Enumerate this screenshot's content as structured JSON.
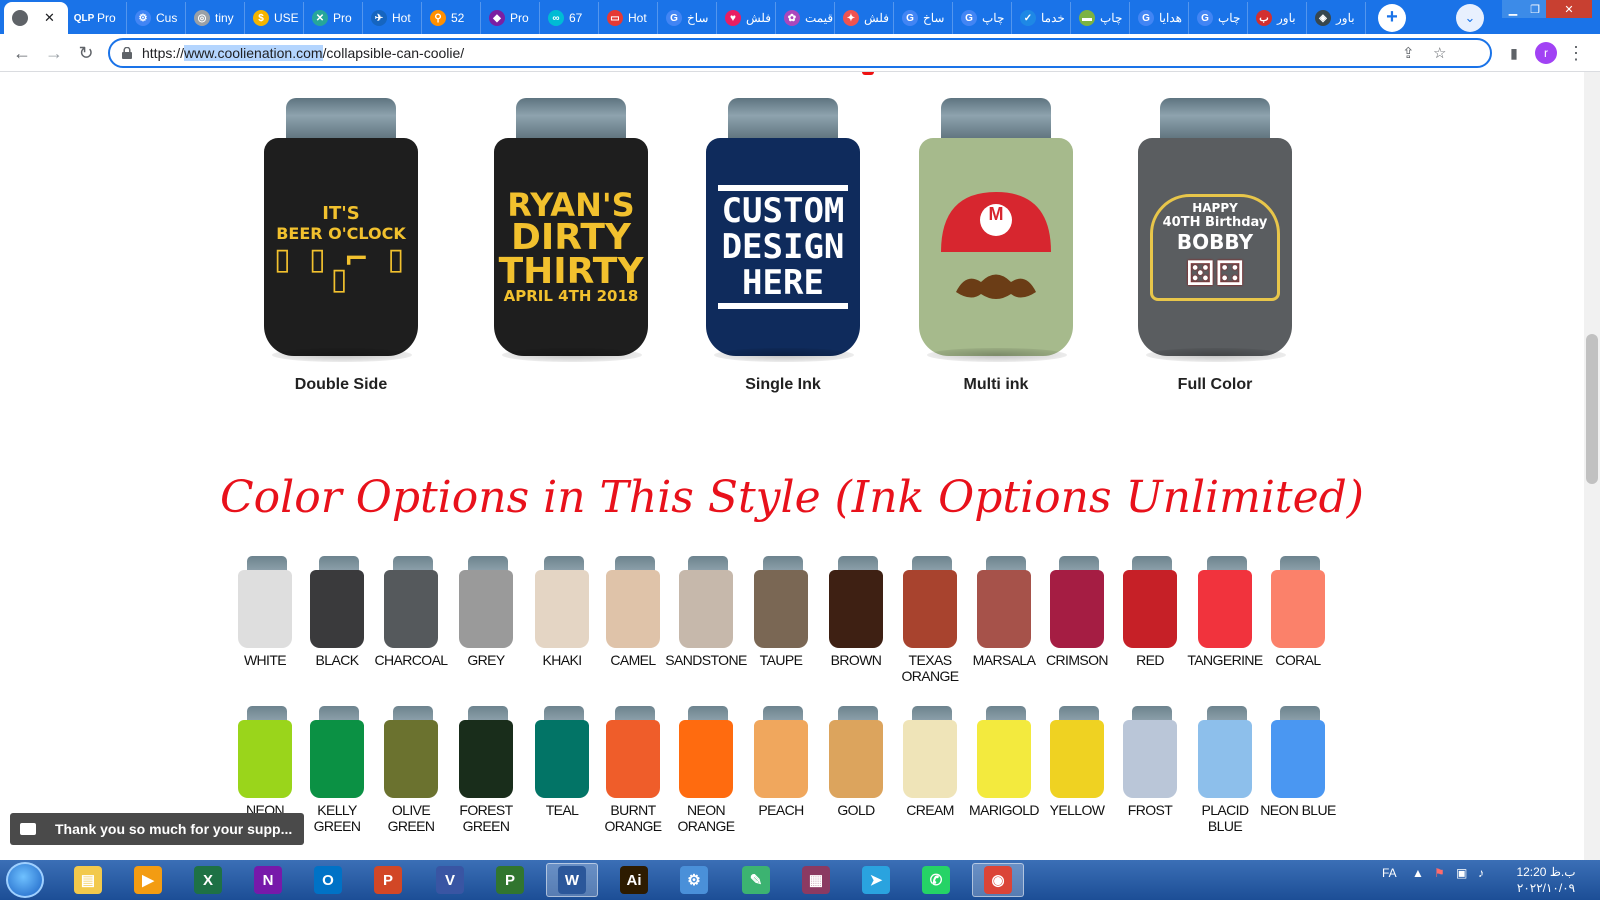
{
  "browser": {
    "tabs": [
      {
        "label": "",
        "favicon": "globe-icon",
        "color": "#5f6368",
        "active": true
      },
      {
        "label": "Pro",
        "favicon": "qlp-icon",
        "color": "#1a73e8",
        "glyph": "QLP"
      },
      {
        "label": "Cus",
        "favicon": "gear-icon",
        "color": "#4285f4",
        "glyph": "⚙"
      },
      {
        "label": "tiny",
        "favicon": "globe-icon",
        "color": "#9aa0a6",
        "glyph": "◎"
      },
      {
        "label": "USE",
        "favicon": "coin-icon",
        "color": "#f4b400",
        "glyph": "$"
      },
      {
        "label": "Pro",
        "favicon": "cross-circle-icon",
        "color": "#26a69a",
        "glyph": "✕"
      },
      {
        "label": "Hot",
        "favicon": "wing-icon",
        "color": "#1565c0",
        "glyph": "✈"
      },
      {
        "label": "52",
        "favicon": "map-pin-icon",
        "color": "#ff8f00",
        "glyph": "⚲"
      },
      {
        "label": "Pro",
        "favicon": "diamond-icon",
        "color": "#7b1fa2",
        "glyph": "◆"
      },
      {
        "label": "67",
        "favicon": "ring-icon",
        "color": "#00bcd4",
        "glyph": "∞"
      },
      {
        "label": "Hot",
        "favicon": "tag-icon",
        "color": "#e53935",
        "glyph": "▭"
      },
      {
        "label": "ساخ",
        "favicon": "google-icon",
        "color": "#4285f4",
        "glyph": "G"
      },
      {
        "label": "فلش",
        "favicon": "heart-icon",
        "color": "#e91e63",
        "glyph": "♥"
      },
      {
        "label": "قیمت",
        "favicon": "gift-icon",
        "color": "#ab47bc",
        "glyph": "✿"
      },
      {
        "label": "فلش",
        "favicon": "fire-icon",
        "color": "#ef5350",
        "glyph": "✦"
      },
      {
        "label": "ساخ",
        "favicon": "google-icon",
        "color": "#4285f4",
        "glyph": "G"
      },
      {
        "label": "چاپ",
        "favicon": "google-icon",
        "color": "#4285f4",
        "glyph": "G"
      },
      {
        "label": "خدما",
        "favicon": "check-badge-icon",
        "color": "#1e88e5",
        "glyph": "✓"
      },
      {
        "label": "چاپ",
        "favicon": "bar-icon",
        "color": "#7cb342",
        "glyph": "▬"
      },
      {
        "label": "هدایا",
        "favicon": "google-icon",
        "color": "#4285f4",
        "glyph": "G"
      },
      {
        "label": "چاپ",
        "favicon": "google-icon",
        "color": "#4285f4",
        "glyph": "G"
      },
      {
        "label": "باور",
        "favicon": "logo-red-icon",
        "color": "#d32f2f",
        "glyph": "ب"
      },
      {
        "label": "باور",
        "favicon": "logo-dark-icon",
        "color": "#37474f",
        "glyph": "◈"
      }
    ],
    "url_prefix": "https://",
    "url_host": "www.coolienation.com",
    "url_path": "/collapsible-can-coolie/",
    "avatar_letter": "r"
  },
  "styles": [
    {
      "label": "Double Side",
      "body_color": "#1e1e1e",
      "design": "beer"
    },
    {
      "label": "",
      "body_color": "#1e1e1e",
      "design": "ryan"
    },
    {
      "label": "Single Ink",
      "body_color": "#0f2b5c",
      "design": "custom"
    },
    {
      "label": "Multi ink",
      "body_color": "#a6ba8c",
      "design": "mario"
    },
    {
      "label": "Full Color",
      "body_color": "#5a5d60",
      "design": "bobby"
    }
  ],
  "designs": {
    "beer": {
      "line1": "IT'S",
      "line2": "BEER O'CLOCK"
    },
    "ryan": {
      "line1": "RYAN'S",
      "line2": "DIRTY",
      "line3": "THIRTY",
      "line4": "APRIL 4TH 2018"
    },
    "custom": {
      "line1": "CUSTOM",
      "line2": "DESIGN",
      "line3": "HERE"
    },
    "mario": {
      "letter": "M"
    },
    "bobby": {
      "line1": "HAPPY",
      "line2": "40TH Birthday",
      "line3": "BOBBY"
    }
  },
  "color_section_title": "Color Options in This Style (Ink Options Unlimited)",
  "colors_row1": [
    {
      "name": "WHITE",
      "hex": "#dedede"
    },
    {
      "name": "BLACK",
      "hex": "#3a3a3c"
    },
    {
      "name": "CHARCOAL",
      "hex": "#55595c"
    },
    {
      "name": "GREY",
      "hex": "#9a9a9a"
    },
    {
      "name": "KHAKI",
      "hex": "#e4d5c4"
    },
    {
      "name": "CAMEL",
      "hex": "#dfc3a9"
    },
    {
      "name": "SANDSTONE",
      "hex": "#c6b8ab"
    },
    {
      "name": "TAUPE",
      "hex": "#7a6754"
    },
    {
      "name": "BROWN",
      "hex": "#3e2013"
    },
    {
      "name": "TEXAS ORANGE",
      "hex": "#a8432e"
    },
    {
      "name": "MARSALA",
      "hex": "#a6524a"
    },
    {
      "name": "CRIMSON",
      "hex": "#a51d43"
    },
    {
      "name": "RED",
      "hex": "#c62027"
    },
    {
      "name": "TANGERINE",
      "hex": "#f1333d"
    },
    {
      "name": "CORAL",
      "hex": "#fb816a"
    }
  ],
  "colors_row2": [
    {
      "name": "NEON",
      "hex": "#9ad51b"
    },
    {
      "name": "KELLY GREEN",
      "hex": "#0b9144"
    },
    {
      "name": "OLIVE GREEN",
      "hex": "#6b722f"
    },
    {
      "name": "FOREST GREEN",
      "hex": "#192d1b"
    },
    {
      "name": "TEAL",
      "hex": "#027466"
    },
    {
      "name": "BURNT ORANGE",
      "hex": "#ef5d2a"
    },
    {
      "name": "NEON ORANGE",
      "hex": "#ff6b0f"
    },
    {
      "name": "PEACH",
      "hex": "#f0a75d"
    },
    {
      "name": "GOLD",
      "hex": "#dca45d"
    },
    {
      "name": "CREAM",
      "hex": "#efe4b8"
    },
    {
      "name": "MARIGOLD",
      "hex": "#f3ea3e"
    },
    {
      "name": "YELLOW",
      "hex": "#efd222"
    },
    {
      "name": "FROST",
      "hex": "#bac6d8"
    },
    {
      "name": "PLACID BLUE",
      "hex": "#8dbfeb"
    },
    {
      "name": "NEON BLUE",
      "hex": "#4a97f2"
    }
  ],
  "toast": {
    "text": "Thank you so much for your supp..."
  },
  "taskbar": {
    "apps": [
      {
        "name": "explorer-icon",
        "color": "#f2c94c",
        "glyph": "▤"
      },
      {
        "name": "media-player-icon",
        "color": "#f39c12",
        "glyph": "▶"
      },
      {
        "name": "excel-icon",
        "color": "#1e7145",
        "glyph": "X"
      },
      {
        "name": "onenote-icon",
        "color": "#7719aa",
        "glyph": "N"
      },
      {
        "name": "outlook-icon",
        "color": "#0072c6",
        "glyph": "O"
      },
      {
        "name": "powerpoint-icon",
        "color": "#d24726",
        "glyph": "P"
      },
      {
        "name": "visio-icon",
        "color": "#3955a3",
        "glyph": "V"
      },
      {
        "name": "project-icon",
        "color": "#31752f",
        "glyph": "P"
      },
      {
        "name": "word-icon",
        "color": "#2b579a",
        "glyph": "W"
      },
      {
        "name": "illustrator-icon",
        "color": "#2d1b00",
        "glyph": "Ai"
      },
      {
        "name": "control-panel-icon",
        "color": "#4a90d9",
        "glyph": "⚙"
      },
      {
        "name": "pen-app-icon",
        "color": "#3cb371",
        "glyph": "✎"
      },
      {
        "name": "winrar-icon",
        "color": "#8b3a62",
        "glyph": "▦"
      },
      {
        "name": "telegram-icon",
        "color": "#2aa3df",
        "glyph": "➤"
      },
      {
        "name": "whatsapp-icon",
        "color": "#25d366",
        "glyph": "✆"
      },
      {
        "name": "chrome-icon",
        "color": "#db4437",
        "glyph": "◉"
      }
    ],
    "lang": "FA",
    "time": "12:20 ب.ظ",
    "date": "۲۰۲۲/۱۰/۰۹"
  }
}
